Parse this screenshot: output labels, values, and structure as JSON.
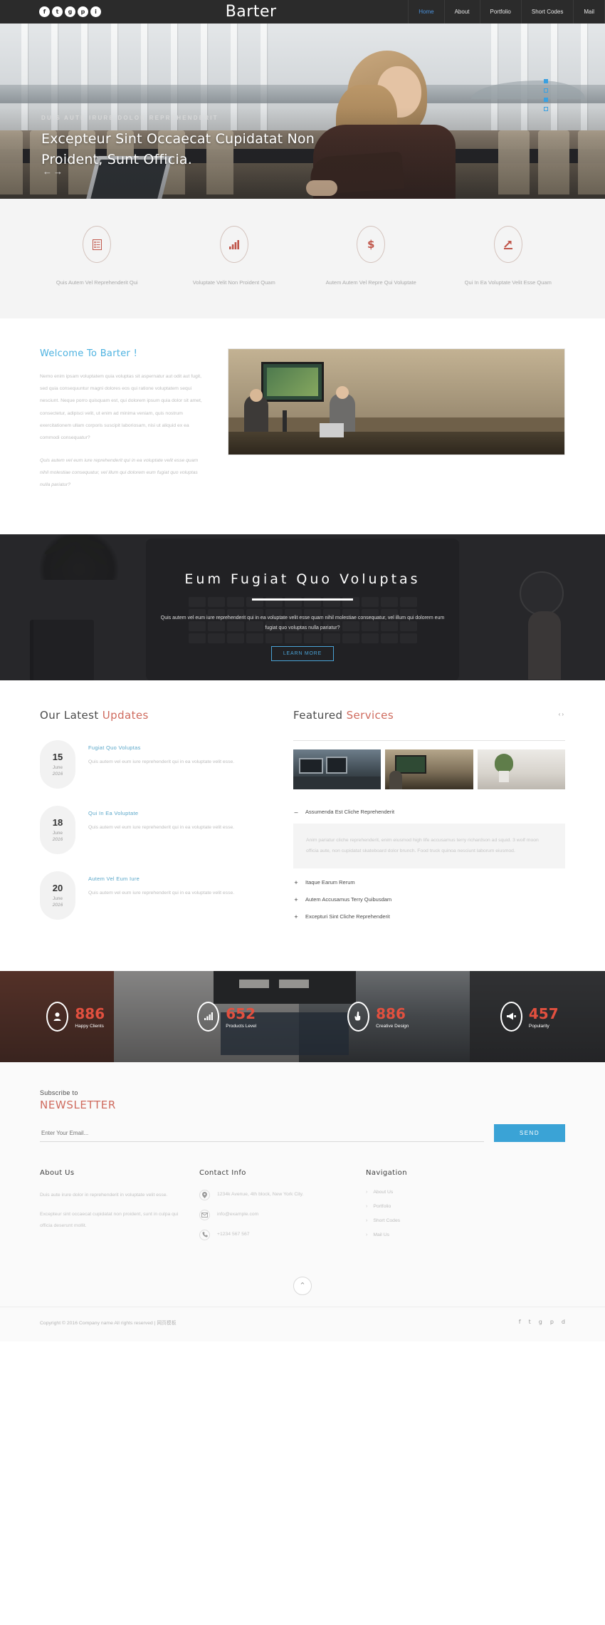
{
  "header": {
    "brand": "Barter",
    "social": [
      {
        "name": "facebook-icon",
        "glyph": "f"
      },
      {
        "name": "twitter-icon",
        "glyph": "t"
      },
      {
        "name": "google-plus-icon",
        "glyph": "g"
      },
      {
        "name": "pinterest-icon",
        "glyph": "p"
      },
      {
        "name": "instagram-icon",
        "glyph": "i"
      }
    ],
    "nav": [
      {
        "label": "Home",
        "active": true
      },
      {
        "label": "About",
        "active": false
      },
      {
        "label": "Portfolio",
        "active": false
      },
      {
        "label": "Short Codes",
        "active": false
      },
      {
        "label": "Mail",
        "active": false
      }
    ]
  },
  "hero": {
    "subtitle": "DUIS AUTE IRURE DOLOR REPREHENDERIT",
    "title": "Excepteur Sint Occaecat Cupidatat Non Proident, Sunt Officia.",
    "arrows": "←→",
    "accent": "#3aa0e0"
  },
  "services": [
    {
      "icon": "list-document-icon",
      "title": "Quis Autem Vel Reprehenderit Qui"
    },
    {
      "icon": "bar-chart-icon",
      "title": "Voluptate Velit Non Proident Quam"
    },
    {
      "icon": "dollar-icon",
      "title": "Autem Autem Vel Repre Qui Voluptate"
    },
    {
      "icon": "arrow-up-growth-icon",
      "title": "Qui In Ea Voluptate Velit Esse Quam"
    }
  ],
  "welcome": {
    "heading": "Welcome To Barter !",
    "paragraph1": "Nemo enim ipsam voluptatem quia voluptas sit aspernatur aut odit aut fugit, sed quia consequuntur magni dolores eos qui ratione voluptatem sequi nesciunt. Neque porro quisquam est, qui dolorem ipsum quia dolor sit amet, consectetur, adipisci velit, ut enim ad minima veniam, quis nostrum exercitationem ullam corporis suscipit laboriosam, nisi ut aliquid ex ea commodi consequatur?",
    "paragraph2": "Quis autem vel eum iure reprehenderit qui in ea voluptate velit esse quam nihil molestiae consequatur, vel illum qui dolorem eum fugiat quo voluptas nulla pariatur?"
  },
  "banner": {
    "heading": "Eum Fugiat Quo Voluptas",
    "paragraph": "Quis autem vel eum iure reprehenderit qui in ea voluptate velit esse quam nihil molestiae consequatur, vel illum qui dolorem eum fugiat quo voluptas nulla pariatur?",
    "button": "LEARN MORE",
    "button_color": "#4aa3d6"
  },
  "updates": {
    "heading_1": "Our Latest ",
    "heading_2": "Updates",
    "items": [
      {
        "day": "15",
        "month": "June",
        "year": "2016",
        "title": "Fugiat Quo Voluptas",
        "text": "Quis autem vel eum iure reprehenderit qui in ea voluptate velit esse."
      },
      {
        "day": "18",
        "month": "June",
        "year": "2016",
        "title": "Qui In Ea Voluptate",
        "text": "Quis autem vel eum iure reprehenderit qui in ea voluptate velit esse."
      },
      {
        "day": "20",
        "month": "June",
        "year": "2016",
        "title": "Autem Vel Eum Iure",
        "text": "Quis autem vel eum iure reprehenderit qui in ea voluptate velit esse."
      }
    ]
  },
  "featured": {
    "heading_1": "Featured ",
    "heading_2": "Services",
    "carousel_nav": "‹›",
    "accordion": [
      {
        "sign": "–",
        "label": "Assumenda Est Cliche Reprehenderit",
        "open": true,
        "body": "Anim pariatur cliche reprehenderit, enim eiusmod high life accusamus terry richardson ad squid. 3 wolf moon officia aute, non cupidatat skateboard dolor brunch. Food truck quinoa nesciunt laborum eiusmod."
      },
      {
        "sign": "+",
        "label": "Itaque Earum Rerum",
        "open": false,
        "body": ""
      },
      {
        "sign": "+",
        "label": "Autem Accusamus Terry Quibusdam",
        "open": false,
        "body": ""
      },
      {
        "sign": "+",
        "label": "Excepturi Sint Cliche Reprehenderit",
        "open": false,
        "body": ""
      }
    ]
  },
  "counters": [
    {
      "icon": "user-icon",
      "number": "886",
      "label": "Happy Clients"
    },
    {
      "icon": "bar-chart-icon",
      "number": "652",
      "label": "Products Level"
    },
    {
      "icon": "hand-pointer-icon",
      "number": "886",
      "label": "Creative Design"
    },
    {
      "icon": "megaphone-icon",
      "number": "457",
      "label": "Popularity"
    }
  ],
  "newsletter": {
    "sub": "Subscribe to",
    "title": "NEWSLETTER",
    "placeholder": "Enter Your Email...",
    "value": "",
    "button": "SEND",
    "button_color": "#3aa3d6"
  },
  "footer": {
    "about": {
      "heading": "About Us",
      "p1": "Duis aute irure dolor in reprehenderit in voluptate velit esse.",
      "p2": "Excepteur sint occaecat cupidatat non proident, sunt in culpa qui officia deserunt mollit."
    },
    "contact": {
      "heading": "Contact Info",
      "items": [
        {
          "icon": "map-pin-icon",
          "text": "1234k Avenue, 4th block, New York City."
        },
        {
          "icon": "envelope-icon",
          "text": "info@example.com"
        },
        {
          "icon": "phone-icon",
          "text": "+1234 567 567"
        }
      ]
    },
    "navigation": {
      "heading": "Navigation",
      "items": [
        "About Us",
        "Portfolio",
        "Short Codes",
        "Mail Us"
      ]
    },
    "to_top_icon": "chevron-up-icon",
    "copyright": "Copyright © 2016 Company name All rights reserved | 网页模板",
    "social": [
      {
        "name": "facebook-icon",
        "glyph": "f"
      },
      {
        "name": "twitter-icon",
        "glyph": "t"
      },
      {
        "name": "google-plus-icon",
        "glyph": "g"
      },
      {
        "name": "pinterest-icon",
        "glyph": "p"
      },
      {
        "name": "dribbble-icon",
        "glyph": "d"
      }
    ]
  }
}
